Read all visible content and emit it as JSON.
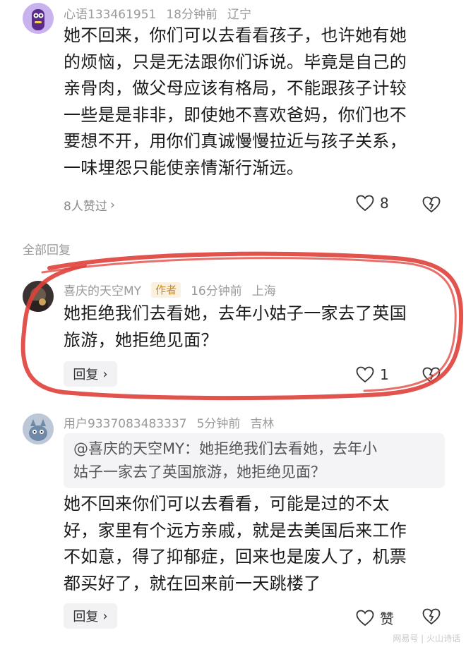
{
  "comment1": {
    "username": "心语133461951",
    "time": "18分钟前",
    "location": "辽宁",
    "text_lines": [
      "她不回来，你们可以去看看孩子，也许她有她",
      "的烦恼，只是无法跟你们诉说。毕竟是自己的",
      "亲骨肉，做父母应该有格局，不能跟孩子计较",
      "一些是是非非，即使她不喜欢爸妈，你们也不",
      "要想不开，用你们真诚慢慢拉近与孩子关系，",
      "一味埋怨只能使亲情渐行渐远。"
    ],
    "likes_text": "8人赞过",
    "like_count": "8"
  },
  "section_label": "全部回复",
  "comment2": {
    "username": "喜庆的天空MY",
    "author_tag": "作者",
    "time": "16分钟前",
    "location": "上海",
    "text_lines": [
      "她拒绝我们去看她，去年小姑子一家去了英国",
      "旅游，她拒绝见面？"
    ],
    "reply_label": "回复",
    "like_count": "1"
  },
  "comment3": {
    "username": "用户9337083483337",
    "time": "5分钟前",
    "location": "吉林",
    "quote_lines": [
      "@喜庆的天空MY：她拒绝我们去看她，去年小",
      "姑子一家去了英国旅游，她拒绝见面？"
    ],
    "text_lines": [
      "她不回来你们可以去看看，可能是过的不太",
      "好，家里有个远方亲戚，就是去美国后来工作",
      "不如意，得了抑郁症，回来也是废人了，机票",
      "都买好了，就在回来前一天跳楼了"
    ],
    "reply_label": "回复",
    "like_label": "赞"
  },
  "watermark": "网易号 | 火山诗话",
  "colors": {
    "annotation_red": "#e0403a",
    "meta_gray": "#9a9a9a",
    "author_tag": "#c58a2c"
  }
}
